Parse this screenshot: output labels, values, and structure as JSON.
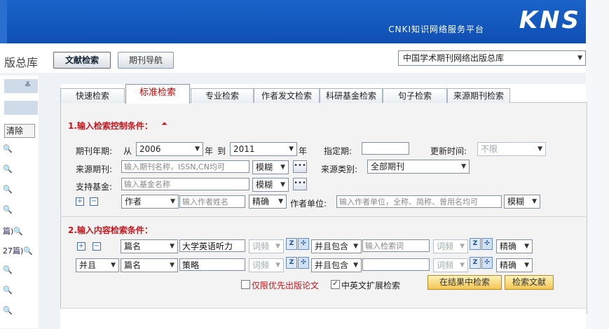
{
  "header": {
    "platform": "CNKI知识网络服务平台",
    "logo": "KNS"
  },
  "toolbar": {
    "db_partial": "版总库",
    "btn_wenxian": "文献检索",
    "btn_qikan": "期刊导航",
    "db_selected": "中国学术期刊网络出版总库"
  },
  "sidebar": {
    "clear": "清除",
    "rows": [
      "",
      "",
      "",
      "",
      "篇)",
      "27篇)",
      "",
      "",
      ""
    ]
  },
  "tabs": [
    "快速检索",
    "标准检索",
    "专业检索",
    "作者发文检索",
    "科研基金检索",
    "句子检索",
    "来源期刊检索"
  ],
  "section1": {
    "title": "1.输入检索控制条件：",
    "year_label": "期刊年期:",
    "from": "从",
    "year_from": "2006",
    "year_unit": "年",
    "to": "到",
    "year_to": "2011",
    "year_unit2": "年",
    "specified_label": "指定期:",
    "update_label": "更新时间:",
    "update_value": "不限",
    "source_label": "来源期刊:",
    "source_placeholder": "输入期刊名称，ISSN,CN均可",
    "fuzzy": "模糊",
    "source_type_label": "来源类别:",
    "source_type_value": "全部期刊",
    "fund_label": "支持基金:",
    "fund_placeholder": "输入基金名称",
    "fuzzy2": "模糊",
    "author_field": "作者",
    "author_placeholder": "输入作者姓名",
    "exact": "精确",
    "org_label": "作者单位:",
    "org_placeholder": "输入作者单位，全称、简称、曾用名均可",
    "fuzzy3": "模糊"
  },
  "section2": {
    "title": "2.输入内容检索条件：",
    "row1": {
      "field": "篇名",
      "term": "大学英语听力",
      "freq": "词频",
      "logic": "并且包含",
      "term2_placeholder": "输入检索词",
      "freq2": "词频",
      "match": "精确"
    },
    "row2": {
      "op": "并且",
      "field": "篇名",
      "term": "策略",
      "freq": "词频",
      "logic": "并且包含",
      "term2": "",
      "freq2": "词频",
      "match": "精确"
    },
    "opt_priority": "仅限优先出版论文",
    "opt_cn_en": "中英文扩展检索",
    "btn_in_results": "在结果中检索",
    "btn_search": "检索文献"
  },
  "colors": {
    "header": "#1256bd",
    "section_title": "#c4161c",
    "accent_btn": "#f3c552"
  }
}
